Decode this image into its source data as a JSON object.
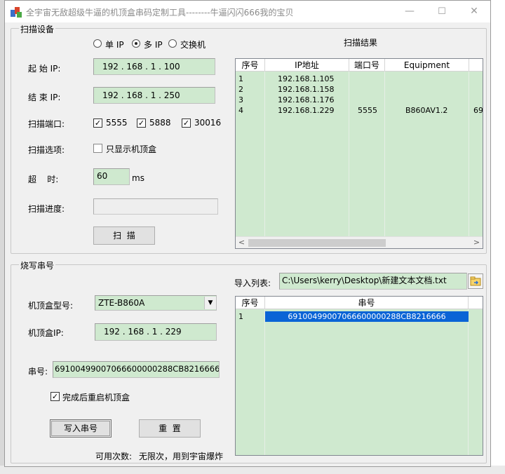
{
  "window": {
    "title": "全宇宙无敌超级牛逼的机顶盒串码定制工具--------牛逼闪闪666我的宝贝",
    "minimize_glyph": "—",
    "maximize_glyph": "☐",
    "close_glyph": "✕"
  },
  "scan": {
    "group_title": "扫描设备",
    "mode_options": [
      "单 IP",
      "多 IP",
      "交换机"
    ],
    "mode_selected": "多 IP",
    "start_ip_label": "起 始 IP:",
    "start_ip": "192 . 168 .  1  . 100",
    "end_ip_label": "结 束 IP:",
    "end_ip": "192 . 168 .  1  . 250",
    "ports_label": "扫描端口:",
    "ports": [
      {
        "label": "5555",
        "checked": true
      },
      {
        "label": "5888",
        "checked": true
      },
      {
        "label": "30016",
        "checked": true
      }
    ],
    "options_label": "扫描选项:",
    "only_stb_label": "只显示机顶盒",
    "only_stb_checked": false,
    "timeout_label": "超    时:",
    "timeout_value": "60",
    "timeout_unit": "ms",
    "progress_label": "扫描进度:",
    "progress": 0,
    "scan_button": "扫  描"
  },
  "scan_results": {
    "title": "扫描结果",
    "columns": [
      "序号",
      "IP地址",
      "端口号",
      "Equipment"
    ],
    "rows": [
      {
        "no": "1",
        "ip": "192.168.1.105",
        "port": "",
        "equipment": "",
        "extra": ""
      },
      {
        "no": "2",
        "ip": "192.168.1.158",
        "port": "",
        "equipment": "",
        "extra": ""
      },
      {
        "no": "3",
        "ip": "192.168.1.176",
        "port": "",
        "equipment": "",
        "extra": ""
      },
      {
        "no": "4",
        "ip": "192.168.1.229",
        "port": "5555",
        "equipment": "B860AV1.2",
        "extra": "69"
      }
    ],
    "scroll_left": "<",
    "scroll_right": ">"
  },
  "burn": {
    "group_title": "烧写串号",
    "import_label": "导入列表:",
    "import_path": "C:\\Users\\kerry\\Desktop\\新建文本文档.txt",
    "model_label": "机顶盒型号:",
    "model_value": "ZTE-B860A",
    "stb_ip_label": "机顶盒IP:",
    "stb_ip": "192 . 168 .  1  . 229",
    "serial_label": "串号:",
    "serial_value": "69100499007066600000288CB8216666",
    "reboot_label": "完成后重启机顶盒",
    "reboot_checked": true,
    "write_button": "写入串号",
    "reset_button": "重  置",
    "usage_label": "可用次数:",
    "usage_value": "无限次，用到宇宙爆炸"
  },
  "serial_list": {
    "columns": [
      "序号",
      "串号"
    ],
    "rows": [
      {
        "no": "1",
        "serial": "69100499007066600000288CB8216666",
        "selected": true
      }
    ]
  },
  "colors": {
    "field_green": "#cfe9cf",
    "selection_blue": "#0a64d6"
  }
}
